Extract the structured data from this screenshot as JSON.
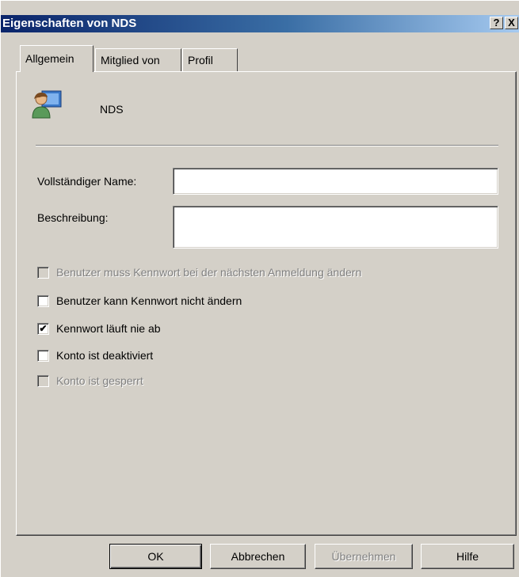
{
  "window": {
    "title": "Eigenschaften von NDS",
    "help_glyph": "?",
    "close_glyph": "X"
  },
  "tabs": [
    {
      "label": "Allgemein",
      "active": true
    },
    {
      "label": "Mitglied von",
      "active": false
    },
    {
      "label": "Profil",
      "active": false
    }
  ],
  "general": {
    "object_name": "NDS",
    "fullname_label": "Vollständiger Name:",
    "fullname_value": "",
    "description_label": "Beschreibung:",
    "description_value": ""
  },
  "checkboxes": [
    {
      "label": "Benutzer muss Kennwort bei der nächsten Anmeldung ändern",
      "checked": false,
      "enabled": false
    },
    {
      "label": "Benutzer kann Kennwort nicht ändern",
      "checked": false,
      "enabled": true
    },
    {
      "label": "Kennwort läuft nie ab",
      "checked": true,
      "enabled": true,
      "mark": "✔"
    },
    {
      "label": "Konto ist deaktiviert",
      "checked": false,
      "enabled": true
    },
    {
      "label": "Konto ist gesperrt",
      "checked": false,
      "enabled": false
    }
  ],
  "buttons": {
    "ok": "OK",
    "cancel": "Abbrechen",
    "apply": "Übernehmen",
    "help": "Hilfe"
  },
  "icons": {
    "user": "user-icon"
  },
  "colors": {
    "face": "#d4d0c8",
    "title_start": "#0a246a",
    "title_end": "#a6caf0",
    "disabled_text": "#808080"
  }
}
